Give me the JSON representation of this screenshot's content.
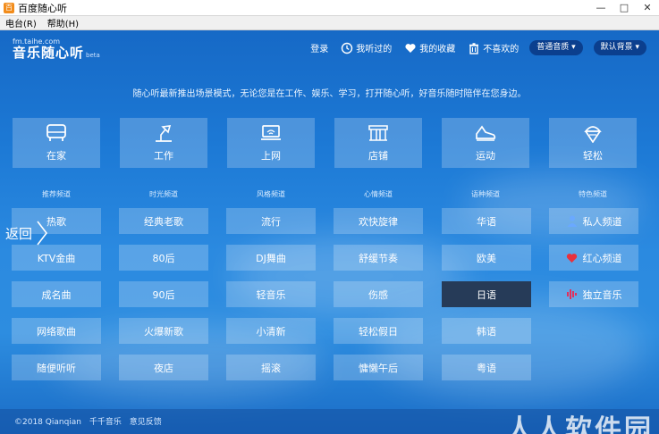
{
  "window": {
    "title": "百度随心听",
    "app_icon": "百"
  },
  "menu": [
    "电台(R)",
    "帮助(H)"
  ],
  "logo": {
    "url": "fm.taihe.com",
    "name": "音乐随心听",
    "beta": "beta"
  },
  "nav": {
    "login": "登录",
    "history": "我听过的",
    "favorites": "我的收藏",
    "dislike": "不喜欢的",
    "quality": "普通音质 ▾",
    "background": "默认背景 ▾"
  },
  "subtitle": "随心听最新推出场景模式，无论您是在工作、娱乐、学习，打开随心听，好音乐随时陪伴在您身边。",
  "scenes": [
    {
      "label": "在家",
      "icon": "sofa-icon"
    },
    {
      "label": "工作",
      "icon": "desk-lamp-icon"
    },
    {
      "label": "上网",
      "icon": "laptop-icon"
    },
    {
      "label": "店铺",
      "icon": "shop-icon"
    },
    {
      "label": "运动",
      "icon": "sneaker-icon"
    },
    {
      "label": "轻松",
      "icon": "ice-cream-icon"
    }
  ],
  "column_heads": [
    "推荐频道",
    "时光频道",
    "风格频道",
    "心情频道",
    "语种频道",
    "特色频道"
  ],
  "back_label": "返回",
  "channels": {
    "col1": [
      "热歌",
      "KTV金曲",
      "成名曲",
      "网络歌曲",
      "随便听听"
    ],
    "col2": [
      "经典老歌",
      "80后",
      "90后",
      "火爆新歌",
      "夜店"
    ],
    "col3": [
      "流行",
      "DJ舞曲",
      "轻音乐",
      "小清新",
      "摇滚"
    ],
    "col4": [
      "欢快旋律",
      "舒缓节奏",
      "伤感",
      "轻松假日",
      "慵懒午后"
    ],
    "col5": [
      "华语",
      "欧美",
      "日语",
      "韩语",
      "粤语"
    ],
    "col6": [
      "私人频道",
      "红心频道",
      "独立音乐"
    ]
  },
  "active_channel": "日语",
  "colors": {
    "heart": "#e8313d",
    "indie": "#e0305e",
    "private": "#6aa9ff"
  },
  "footer": {
    "copyright": "©2018 Qianqian",
    "link1": "千千音乐",
    "link2": "意见反馈",
    "watermark": "人人软件园"
  }
}
